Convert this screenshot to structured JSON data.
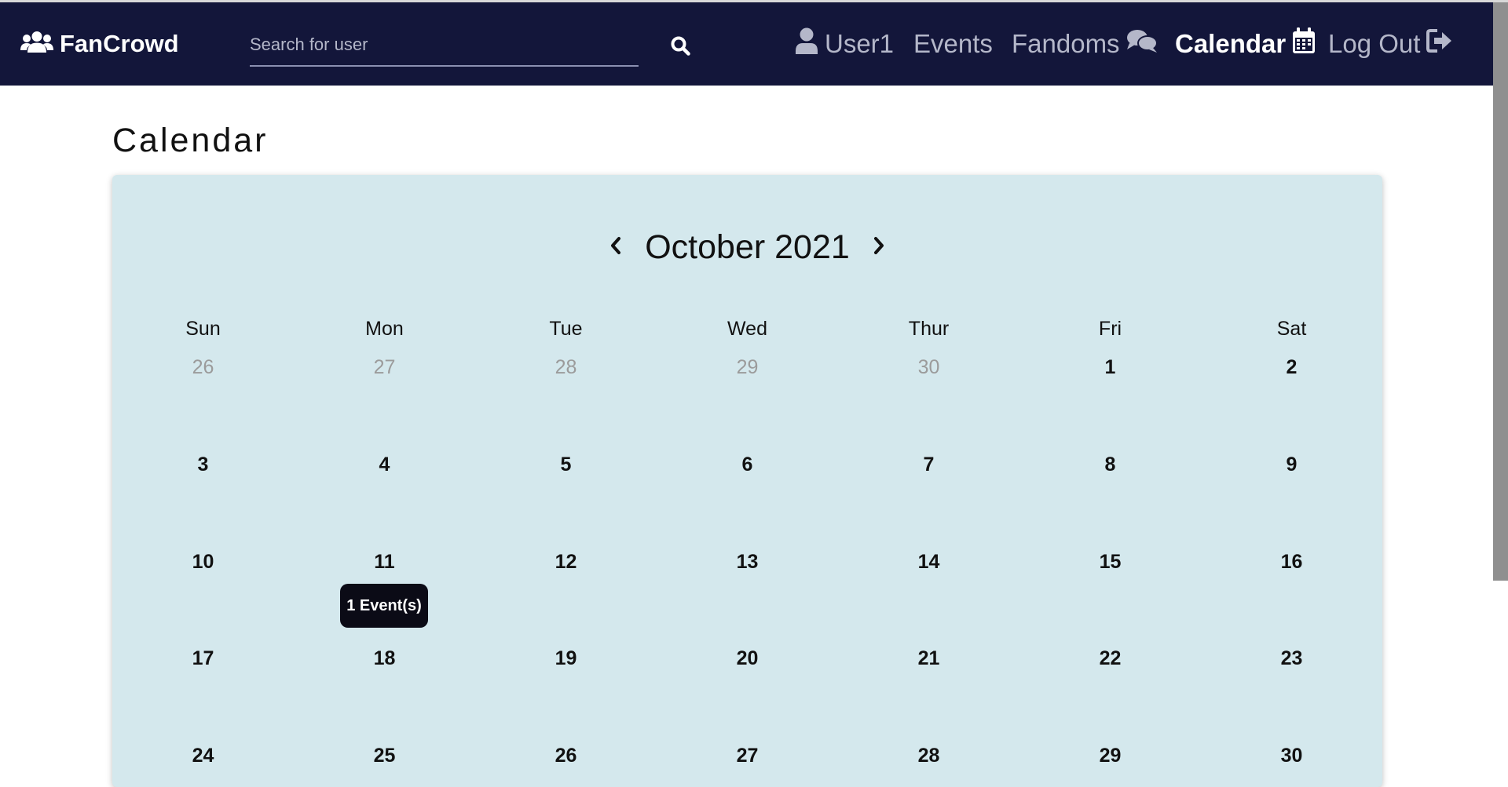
{
  "navbar": {
    "brand": "FanCrowd",
    "search_placeholder": "Search for user",
    "items": [
      {
        "label": "User1",
        "icon": "user-icon"
      },
      {
        "label": "Events"
      },
      {
        "label": "Fandoms",
        "icon": "comments-icon"
      },
      {
        "label": "Calendar",
        "icon": "calendar-icon",
        "active": true
      },
      {
        "label": "Log Out",
        "icon": "sign-out-icon"
      }
    ]
  },
  "page": {
    "title": "Calendar"
  },
  "calendar": {
    "month_label": "October 2021",
    "weekdays": [
      "Sun",
      "Mon",
      "Tue",
      "Wed",
      "Thur",
      "Fri",
      "Sat"
    ],
    "weeks": [
      [
        "26",
        "27",
        "28",
        "29",
        "30",
        "1",
        "2"
      ],
      [
        "3",
        "4",
        "5",
        "6",
        "7",
        "8",
        "9"
      ],
      [
        "10",
        "11",
        "12",
        "13",
        "14",
        "15",
        "16"
      ],
      [
        "17",
        "18",
        "19",
        "20",
        "21",
        "22",
        "23"
      ],
      [
        "24",
        "25",
        "26",
        "27",
        "28",
        "29",
        "30"
      ]
    ],
    "event_badge": {
      "day": "11",
      "label": "1 Event(s)"
    }
  },
  "colors": {
    "navbar_bg": "#13163a",
    "calendar_bg": "#d4e8ed",
    "muted_day": "#9b9b9b",
    "badge_bg": "#0b0b16"
  }
}
